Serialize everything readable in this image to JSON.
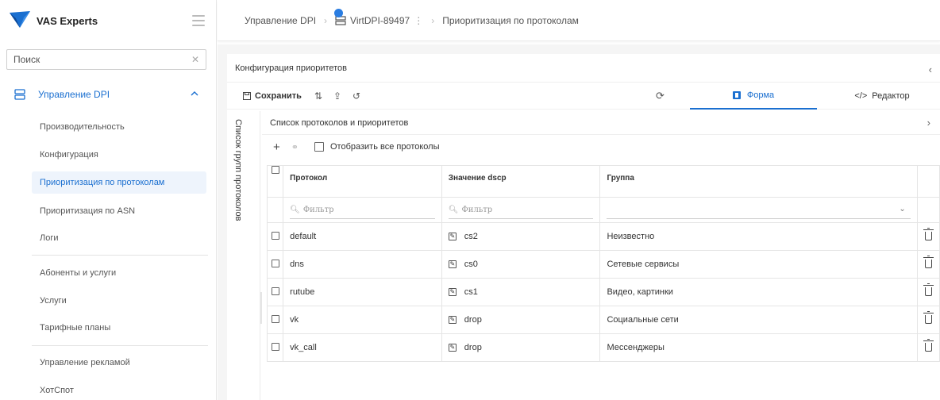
{
  "app": {
    "name": "VAS Experts",
    "brand_color": "#1a6fd0"
  },
  "sidebar": {
    "search_placeholder": "Поиск",
    "group": {
      "label": "Управление DPI",
      "icon": "server-stack-icon"
    },
    "items": [
      {
        "label": "Производительность"
      },
      {
        "label": "Конфигурация"
      },
      {
        "label": "Приоритизация по протоколам",
        "active": true
      },
      {
        "label": "Приоритизация по ASN"
      },
      {
        "label": "Логи"
      },
      {
        "label": "Абоненты и услуги"
      },
      {
        "label": "Услуги"
      },
      {
        "label": "Тарифные планы"
      },
      {
        "label": "Управление рекламой"
      },
      {
        "label": "ХотСпот"
      }
    ]
  },
  "breadcrumb": {
    "root": "Управление DPI",
    "device": "VirtDPI-89497",
    "current": "Приоритизация по протоколам"
  },
  "card": {
    "title": "Конфигурация приоритетов",
    "toolbar": {
      "save_label": "Сохранить"
    },
    "tabs": {
      "form": "Форма",
      "editor": "Редактор"
    },
    "vertical_label": "Список групп протоколов",
    "subpanel": {
      "title": "Список протоколов и приоритетов",
      "show_all_label": "Отобразить все протоколы"
    }
  },
  "table": {
    "columns": {
      "protocol": "Протокол",
      "dscp": "Значение dscp",
      "group": "Группа"
    },
    "filter_placeholder": "Фильтр",
    "rows": [
      {
        "protocol": "default",
        "dscp": "cs2",
        "group": "Неизвестно"
      },
      {
        "protocol": "dns",
        "dscp": "cs0",
        "group": "Сетевые сервисы"
      },
      {
        "protocol": "rutube",
        "dscp": "cs1",
        "group": "Видео, картинки"
      },
      {
        "protocol": "vk",
        "dscp": "drop",
        "group": "Социальные сети"
      },
      {
        "protocol": "vk_call",
        "dscp": "drop",
        "group": "Мессенджеры"
      }
    ]
  }
}
